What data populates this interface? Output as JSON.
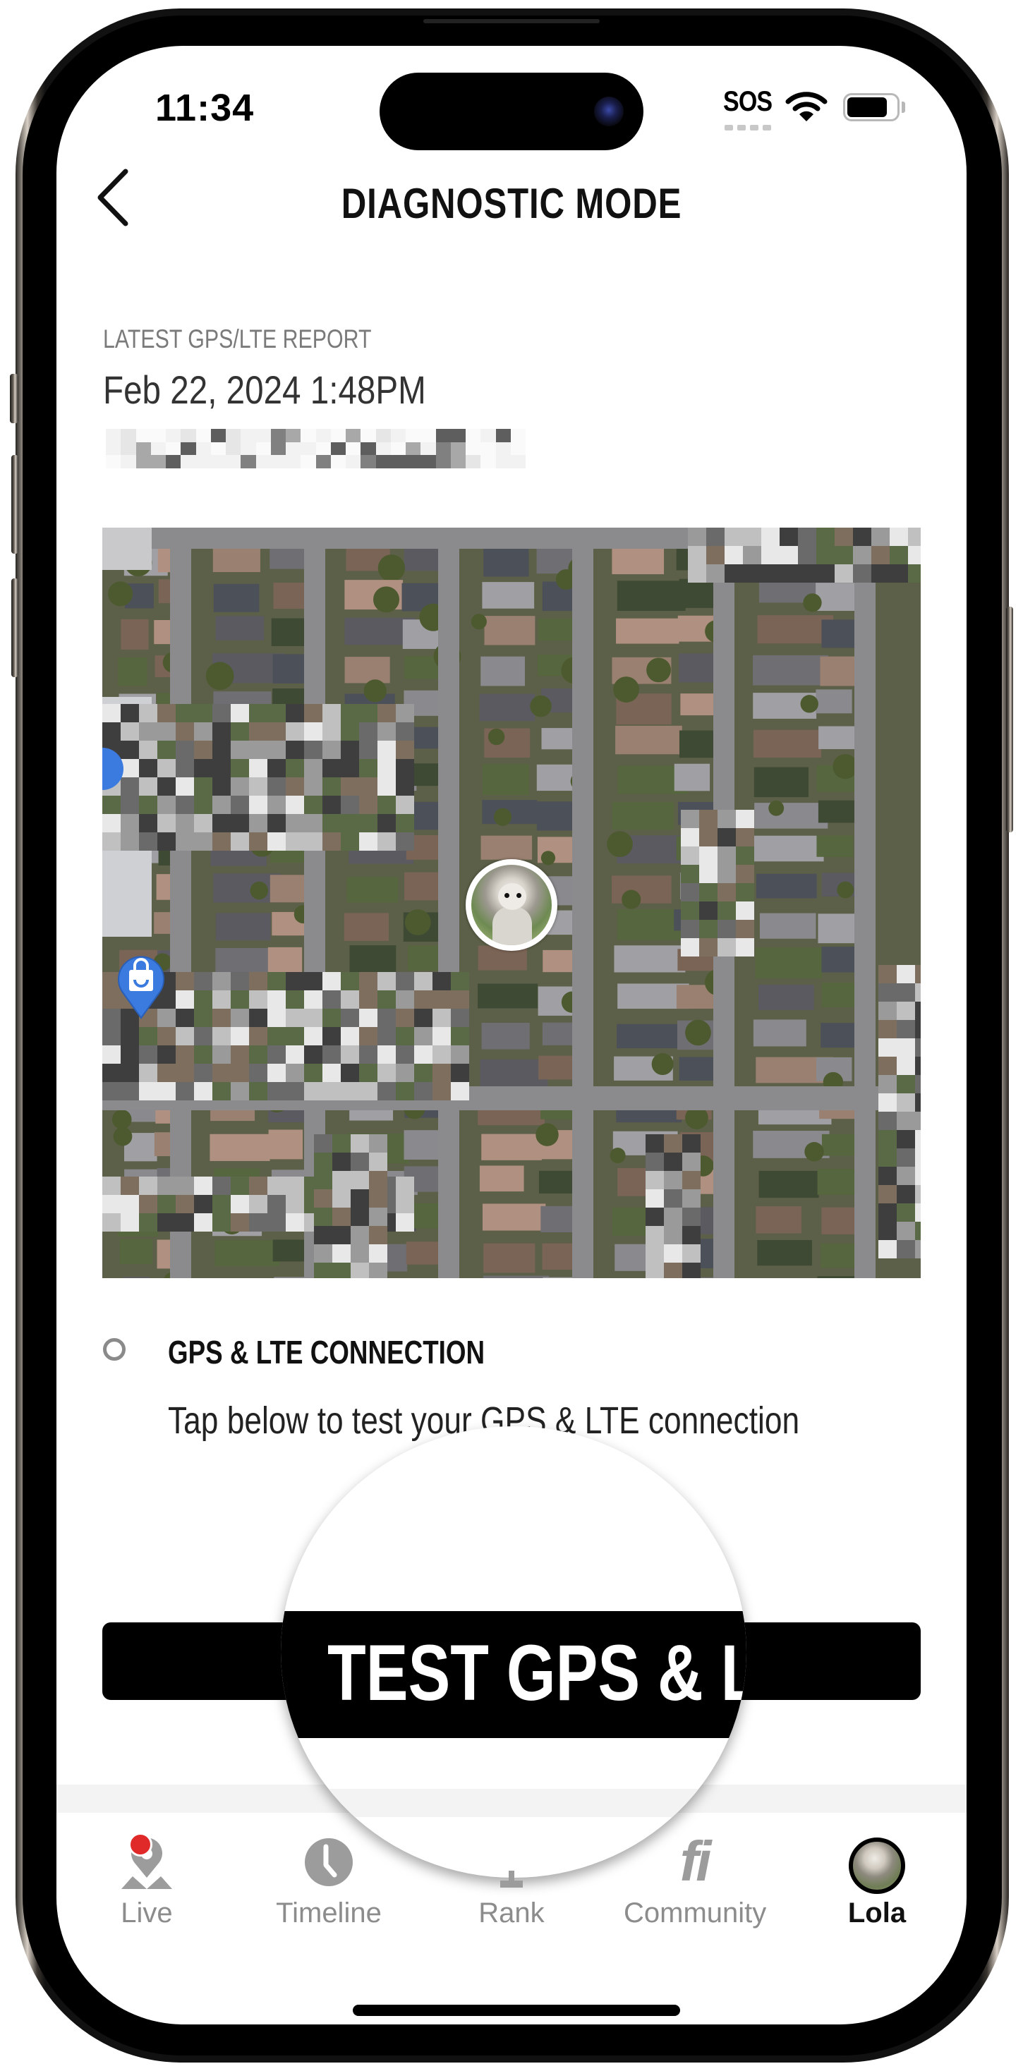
{
  "status_bar": {
    "time": "11:34",
    "carrier_status": "SOS",
    "wifi_icon": "wifi-icon",
    "battery_level": 0.9
  },
  "header": {
    "back_icon": "chevron-left-icon",
    "title": "DIAGNOSTIC MODE"
  },
  "report": {
    "label": "LATEST GPS/LTE REPORT",
    "datetime": "Feb 22, 2024 1:48PM",
    "address": "[redacted address]"
  },
  "map": {
    "pet_marker": "pet-avatar-marker",
    "poi_icons": [
      "shopping-bag-pin-icon",
      "location-pin-icon"
    ]
  },
  "connection": {
    "status_icon": "status-circle-icon",
    "heading": "GPS & LTE CONNECTION",
    "description": "Tap below to test your GPS & LTE connection"
  },
  "actions": {
    "test_button_label": "TEST GPS & LTE"
  },
  "tab_bar": {
    "items": [
      {
        "label": "Live",
        "icon": "location-pin-icon",
        "badge": true,
        "active": false
      },
      {
        "label": "Timeline",
        "icon": "clock-icon",
        "active": false
      },
      {
        "label": "Rank",
        "icon": "podium-icon",
        "active": false
      },
      {
        "label": "Community",
        "icon": "fi-logo-icon",
        "logo_text": "fi",
        "active": false
      },
      {
        "label": "Lola",
        "icon": "pet-avatar-icon",
        "active": true
      }
    ]
  },
  "colors": {
    "accent": "#000000",
    "badge": "#e02a2a",
    "inactive_tab": "#8c8c8c",
    "map_pin": "#3b7be0"
  }
}
